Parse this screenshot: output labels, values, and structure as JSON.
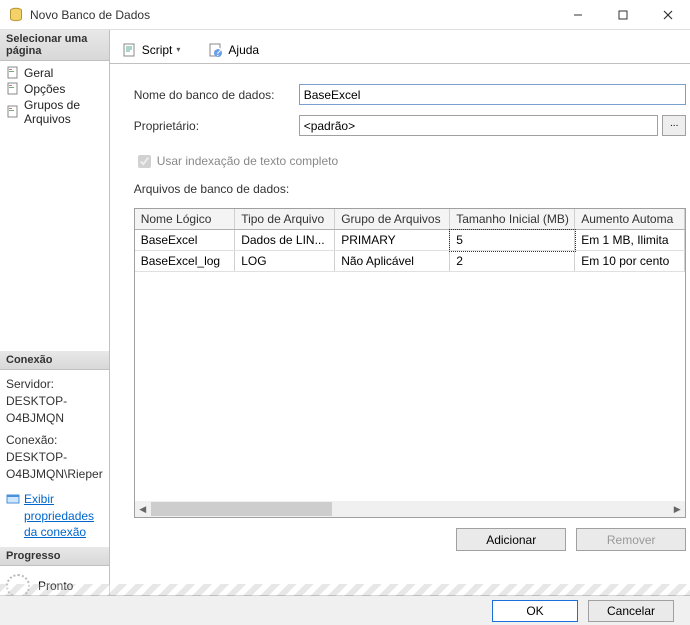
{
  "window": {
    "title": "Novo Banco de Dados"
  },
  "sidebar": {
    "select_header": "Selecionar uma página",
    "items": [
      {
        "label": "Geral"
      },
      {
        "label": "Opções"
      },
      {
        "label": "Grupos de Arquivos"
      }
    ],
    "connection_header": "Conexão",
    "server_label": "Servidor:",
    "server_value": "DESKTOP-O4BJMQN",
    "conn_label": "Conexão:",
    "conn_value": "DESKTOP-O4BJMQN\\Rieper",
    "view_props": "Exibir propriedades da conexão",
    "progress_header": "Progresso",
    "progress_status": "Pronto"
  },
  "toolbar": {
    "script_label": "Script",
    "help_label": "Ajuda"
  },
  "form": {
    "dbname_label": "Nome do banco de dados:",
    "dbname_value": "BaseExcel",
    "owner_label": "Proprietário:",
    "owner_value": "<padrão>",
    "browse_label": "...",
    "fulltext_label": "Usar indexação de texto completo",
    "files_label": "Arquivos de banco de dados:"
  },
  "grid": {
    "headers": [
      "Nome Lógico",
      "Tipo de Arquivo",
      "Grupo de Arquivos",
      "Tamanho Inicial (MB)",
      "Aumento Automa"
    ],
    "rows": [
      {
        "c0": "BaseExcel",
        "c1": "Dados de LIN...",
        "c2": "PRIMARY",
        "c3": "5",
        "c4": "Em 1 MB, Ilimita"
      },
      {
        "c0": "BaseExcel_log",
        "c1": "LOG",
        "c2": "Não Aplicável",
        "c3": "2",
        "c4": "Em 10 por cento"
      }
    ]
  },
  "buttons": {
    "add": "Adicionar",
    "remove": "Remover",
    "ok": "OK",
    "cancel": "Cancelar"
  }
}
